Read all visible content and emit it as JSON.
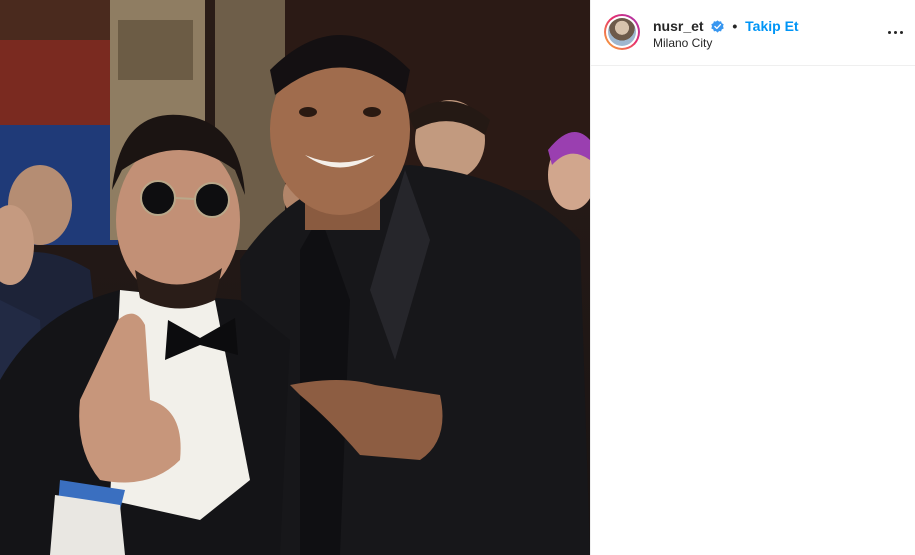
{
  "post": {
    "photo_alt": "Two men in black tuxedos smiling and pointing at each other"
  },
  "header": {
    "username": "nusr_et",
    "separator": "•",
    "follow_label": "Takip Et",
    "location": "Milano City"
  },
  "icons": {
    "verified": "verified-badge-icon",
    "more": "more-options-icon"
  },
  "colors": {
    "follow": "#0095f6",
    "verified": "#3897f0",
    "text": "#262626"
  }
}
